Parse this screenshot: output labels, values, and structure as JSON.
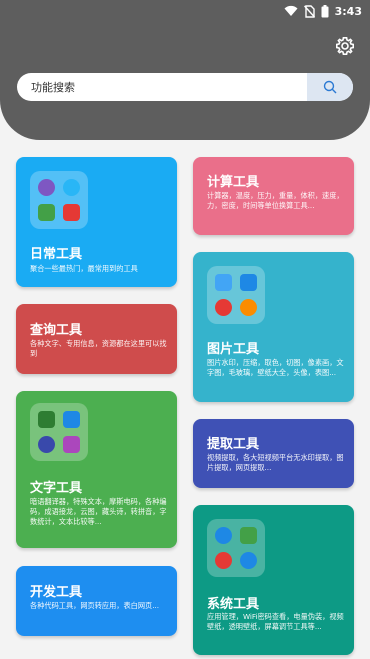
{
  "status": {
    "time": "3:43"
  },
  "search": {
    "placeholder": "功能搜索"
  },
  "cards": {
    "daily": {
      "title": "日常工具",
      "desc": "聚合一些最热门，最常用到的工具",
      "color": "#1aabf3"
    },
    "calc": {
      "title": "计算工具",
      "desc": "计算器，温度，压力，重量，体积，速度，力，密度，时间等单位换算工具...",
      "color": "#ea6f8a"
    },
    "image": {
      "title": "图片工具",
      "desc": "图片水印，压缩，取色，切图，像素画，文字图，毛玻璃，壁纸大全，头像，表图...",
      "color": "#35b3cc"
    },
    "query": {
      "title": "查询工具",
      "desc": "各种文字、专用信息，资源都在这里可以找到",
      "color": "#cf4c4c"
    },
    "extract": {
      "title": "提取工具",
      "desc": "视频提取，各大短视频平台无水印提取，图片提取，网页提取...",
      "color": "#3f51b5"
    },
    "text": {
      "title": "文字工具",
      "desc": "暗语翻译器，特殊文本，摩斯电码，各种编码，成语接龙，云图，藏头诗，转拼音，字数统计，文本比较等...",
      "color": "#4caf50"
    },
    "system": {
      "title": "系统工具",
      "desc": "应用管理，WiFi密码查看，电量伪装，视频壁纸，透明壁纸，屏幕调节工具等...",
      "color": "#0d9a85"
    },
    "dev": {
      "title": "开发工具",
      "desc": "各种代码工具，网页转应用，表白网页...",
      "color": "#1e8ef0"
    }
  }
}
